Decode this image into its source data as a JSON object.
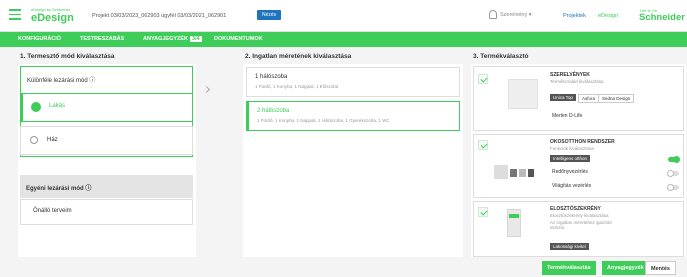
{
  "header": {
    "logo_small": "eDesign by Schneider",
    "logo_main": "eDesign",
    "project": "Projekt 03/03/2023_062903 ügyfél 03/03/2021_062901",
    "badge": "Nézés",
    "user": "Szerelvény ▾",
    "link1": "Projektek",
    "link2": "eDesign",
    "brand_small": "Life Is On",
    "brand": "Schneider"
  },
  "nav": {
    "items": [
      "KONFIGURÁCIÓ",
      "TESTRESZABÁS",
      "ANYAGJEGYZÉK",
      "DOKUMENTUMOK"
    ],
    "count": "3/4"
  },
  "columns": {
    "col1_title": "1. Termesztő mód kiválasztása",
    "col2_title": "2. Ingatlan méretének kiválasztása",
    "col3_title": "3. Termékválasztó"
  },
  "col1": {
    "section_title": "Különféle lezárási mód ⓘ",
    "opt_selected": "Lakás",
    "opt_other": "Ház",
    "grey_title": "Egyéni lezárási mód ⓘ",
    "grey_option": "Önálló terveim"
  },
  "col2": {
    "opt1_title": "1 hálószoba",
    "opt1_desc": "1 Fürdő, 1 Konyha, 1 Nappali, 1 Előszoba",
    "opt2_title": "2 hálószoba",
    "opt2_desc": "1 Fürdő, 1 Konyha, 1 Nappali, 1 Hálószoba, 1 Gyerekszoba, 1 WC"
  },
  "col3": {
    "p1_title": "SZERELVÉNYEK",
    "p1_sub": "Termékcsalád kiválasztása",
    "p1_tags": [
      "Unica Top",
      "Asfora",
      "Sedna Design"
    ],
    "p1_variant": "Merten D-Life",
    "p2_title": "OKOSOTTHON RENDSZER",
    "p2_sub": "Funkciók kiválasztása",
    "p2_tag": "Intelligens otthon",
    "p2_opt1": "Redőnyvezérlés",
    "p2_opt2": "Világítás vezérlés",
    "p3_title": "ELOSZTÓSZEKRÉNY",
    "p3_sub": "Elosztószekrény kiválasztása",
    "p3_desc": "Az ingatlan méretéhez igazított elosztó",
    "p3_tag": "Lakossági kivitel"
  },
  "buttons": {
    "b1": "Termékválasztás",
    "b2": "Anyagjegyzék",
    "b3": "Mentés"
  },
  "colors": {
    "accent": "#3dcd58",
    "link": "#1e73be"
  }
}
